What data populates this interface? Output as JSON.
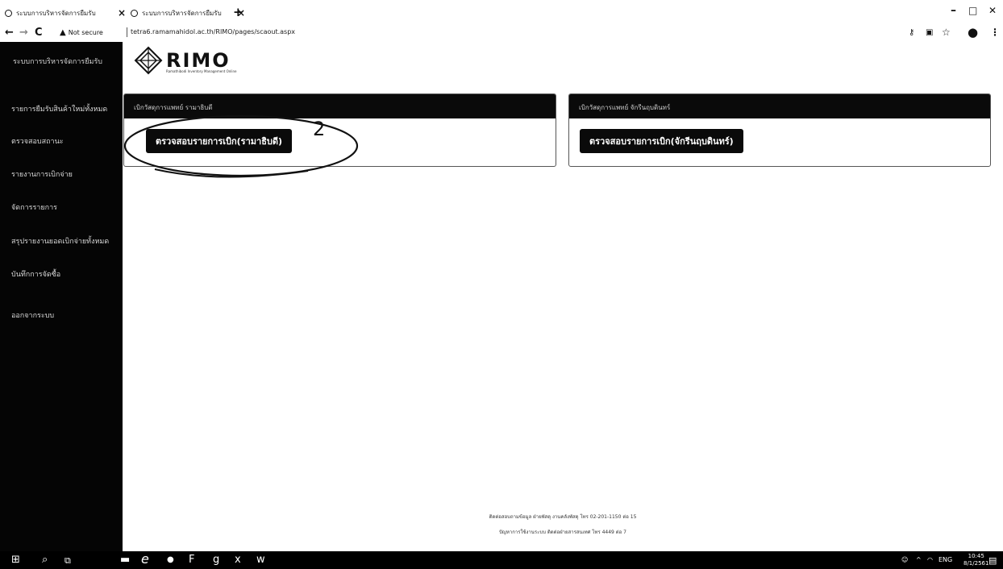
{
  "browser": {
    "tabs": [
      {
        "title": "ระบบการบริหารจัดการยืมรับ"
      },
      {
        "title": "ระบบการบริหารจัดการยืมรับ"
      }
    ],
    "new_tab": "+",
    "window_controls": {
      "minimize": "–",
      "maximize": "□",
      "close": "✕"
    },
    "security_label": "Not secure",
    "url": "tetra6.ramamahidol.ac.th/RIMO/pages/scaout.aspx",
    "nav": {
      "back": "←",
      "forward": "→",
      "reload": "C"
    },
    "toolbar_icons": {
      "key": "⚷",
      "extensions": "▣",
      "star": "☆",
      "profile": "●",
      "menu": "⋮"
    }
  },
  "logo": {
    "text": "RIMO",
    "subtitle": "Ramathibodi Inventory Management Online"
  },
  "sidebar": {
    "header": "ระบบการบริหารจัดการยืมรับ",
    "items": [
      {
        "label": "รายการยืมรับสินค้าใหม่ทั้งหมด"
      },
      {
        "label": "ตรวจสอบสถานะ"
      },
      {
        "label": "รายงานการเบิกจ่าย"
      },
      {
        "label": "จัดการรายการ"
      },
      {
        "label": "สรุปรายงานยอดเบิกจ่ายทั้งหมด"
      },
      {
        "label": "บันทึกการจัดซื้อ"
      },
      {
        "label": "ออกจากระบบ"
      }
    ]
  },
  "panels": [
    {
      "header": "เบิกวัสดุการแพทย์ รามาธิบดี",
      "button": "ตรวจสอบรายการเบิก(รามาธิบดี)"
    },
    {
      "header": "เบิกวัสดุการแพทย์ จักรีนฤบดินทร์",
      "button": "ตรวจสอบรายการเบิก(จักรีนฤบดินทร์)"
    }
  ],
  "annotation": {
    "number": "2"
  },
  "footer": {
    "line1": "ติดต่อสอบถามข้อมูล ฝ่ายพัสดุ งานคลังพัสดุ โทร 02-201-1150 ต่อ 15",
    "line2": "ปัญหาการใช้งานระบบ ติดต่อฝ่ายสารสนเทศ โทร 4449 ต่อ 7"
  },
  "taskbar": {
    "icons": {
      "start": "⊞",
      "search": "⌕",
      "taskview": "⧉",
      "files": "▬",
      "edge": "e",
      "chat": "●",
      "app1": "F",
      "app2": "g",
      "app3": "x",
      "app4": "w"
    },
    "language": "ENG",
    "time": "10:45",
    "date": "8/1/2561",
    "notification": "▤"
  }
}
